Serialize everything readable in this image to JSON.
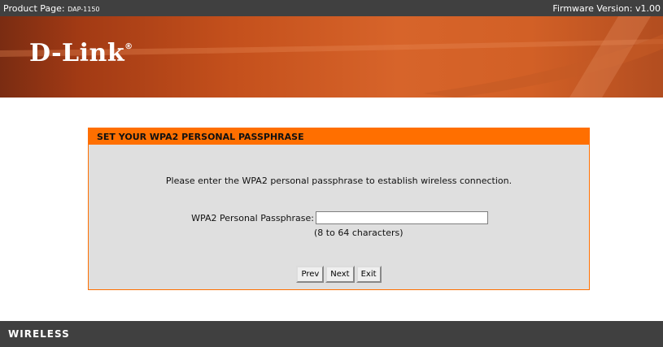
{
  "topbar": {
    "product_label": "Product Page: ",
    "product_model": "DAP-1150",
    "firmware": "Firmware Version: v1.00"
  },
  "banner": {
    "logo_text": "D-Link",
    "logo_mark": "®",
    "accent_color": "#ff6f00"
  },
  "wizard": {
    "title": "SET YOUR WPA2 PERSONAL PASSPHRASE",
    "intro": "Please enter the WPA2 personal passphrase to establish wireless connection.",
    "passphrase_label": "WPA2 Personal Passphrase:",
    "passphrase_value": "",
    "hint": "(8 to 64 characters)",
    "buttons": {
      "prev": "Prev",
      "next": "Next",
      "exit": "Exit"
    }
  },
  "footer": {
    "label": "WIRELESS"
  }
}
